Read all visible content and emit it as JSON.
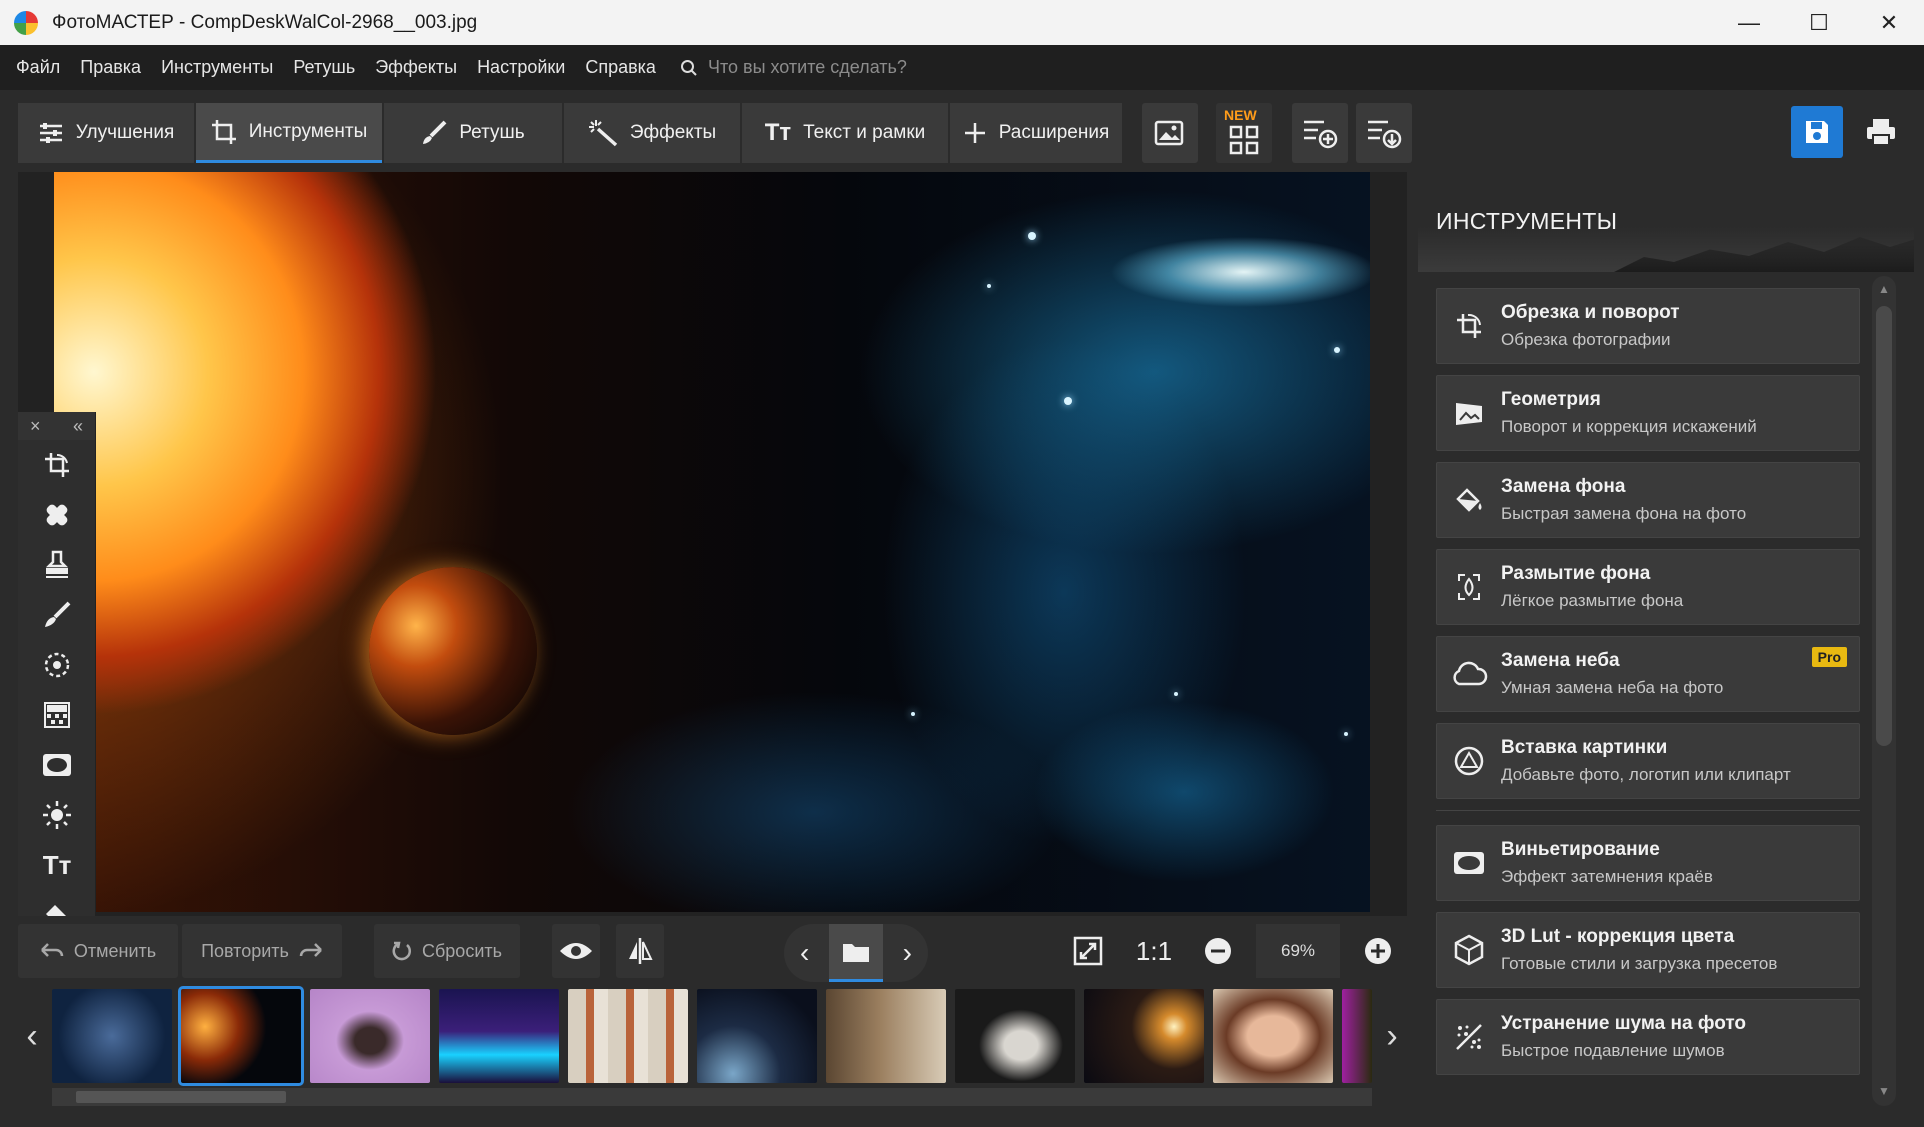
{
  "window": {
    "title": "ФотоМАСТЕР - CompDeskWalCol-2968__003.jpg",
    "minimize": "—",
    "maximize": "☐",
    "close": "✕"
  },
  "menu": {
    "items": [
      "Файл",
      "Правка",
      "Инструменты",
      "Ретушь",
      "Эффекты",
      "Настройки",
      "Справка"
    ],
    "search_placeholder": "Что вы хотите сделать?"
  },
  "tabs": [
    {
      "label": "Улучшения",
      "icon": "sliders-icon"
    },
    {
      "label": "Инструменты",
      "icon": "crop-icon",
      "active": true
    },
    {
      "label": "Ретушь",
      "icon": "brush-icon"
    },
    {
      "label": "Эффекты",
      "icon": "magic-wand-icon"
    },
    {
      "label": "Текст и рамки",
      "icon": "text-icon"
    },
    {
      "label": "Расширения",
      "icon": "plus-icon"
    }
  ],
  "toolbar": {
    "new_badge": "NEW"
  },
  "bottom": {
    "undo": "Отменить",
    "redo": "Повторить",
    "reset": "Сбросить",
    "one_to_one": "1:1",
    "zoom": "69%"
  },
  "right_panel": {
    "title": "ИНСТРУМЕНТЫ",
    "tools": [
      {
        "title": "Обрезка и поворот",
        "subtitle": "Обрезка фотографии",
        "icon": "crop-rotate-icon"
      },
      {
        "title": "Геометрия",
        "subtitle": "Поворот и коррекция искажений",
        "icon": "geometry-icon"
      },
      {
        "title": "Замена фона",
        "subtitle": "Быстрая замена фона на фото",
        "icon": "paint-bucket-icon"
      },
      {
        "title": "Размытие фона",
        "subtitle": "Лёгкое размытие фона",
        "icon": "blur-drop-icon"
      },
      {
        "title": "Замена неба",
        "subtitle": "Умная замена неба на фото",
        "icon": "cloud-icon",
        "badge": "Pro"
      },
      {
        "title": "Вставка картинки",
        "subtitle": "Добавьте фото, логотип или клипарт",
        "icon": "insert-image-icon"
      }
    ],
    "tools2": [
      {
        "title": "Виньетирование",
        "subtitle": "Эффект затемнения краёв",
        "icon": "vignette-icon"
      },
      {
        "title": "3D Lut - коррекция цвета",
        "subtitle": "Готовые стили и загрузка пресетов",
        "icon": "lut-cube-icon"
      },
      {
        "title": "Устранение шума на фото",
        "subtitle": "Быстрое подавление шумов",
        "icon": "noise-icon"
      }
    ]
  },
  "colors": {
    "accent": "#2f8be0",
    "save": "#1f7ad4",
    "pro_badge": "#e8b911"
  }
}
